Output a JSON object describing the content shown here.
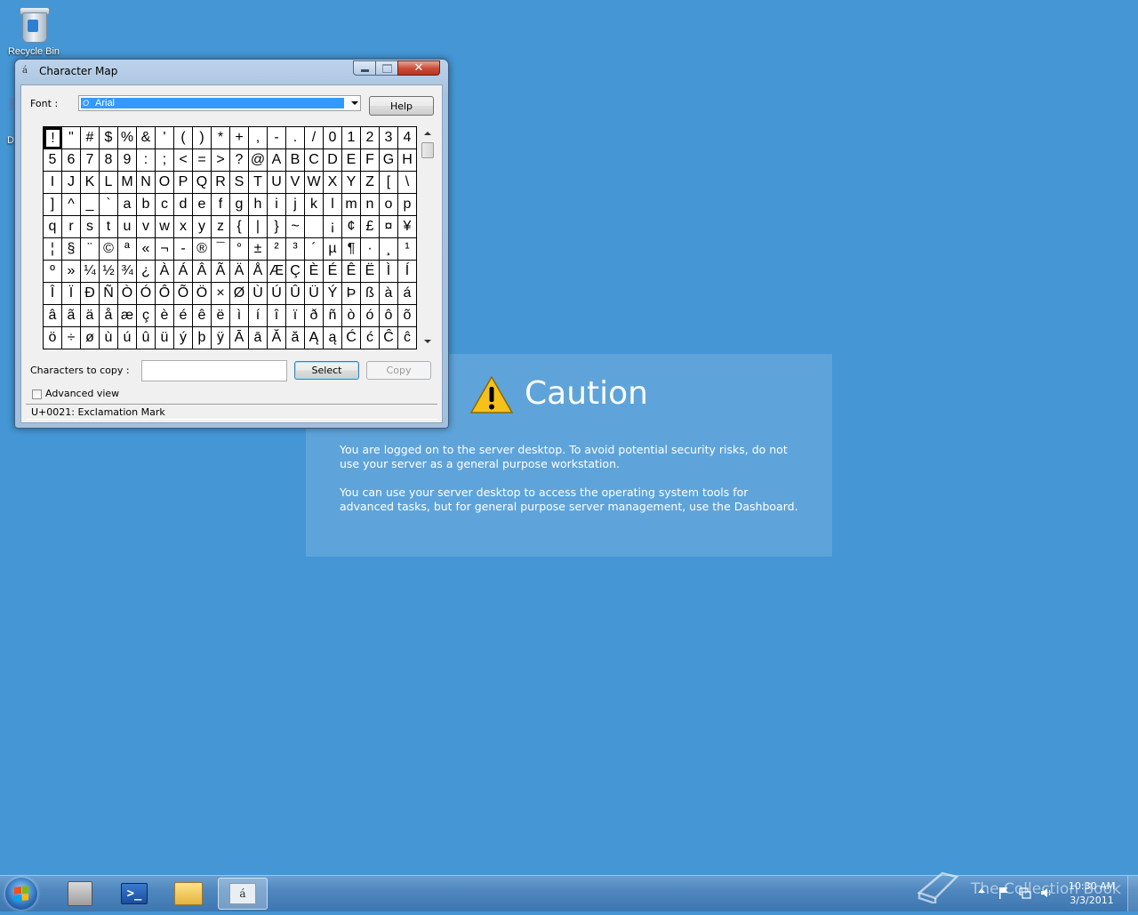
{
  "desktop": {
    "recycle_bin_label": "Recycle Bin",
    "second_icon_label": "D"
  },
  "caution": {
    "title": "Caution",
    "paragraph1": "You are logged on to the server desktop. To avoid potential security risks, do not use your server as a general purpose workstation.",
    "paragraph2": "You can use your server desktop to access the operating system tools for advanced tasks, but for general purpose server management, use the Dashboard."
  },
  "charmap": {
    "title": "Character Map",
    "font_label": "Font :",
    "font_value": "Arial",
    "help_label": "Help",
    "chars_to_copy_label": "Characters to copy :",
    "chars_to_copy_value": "",
    "select_label": "Select",
    "copy_label": "Copy",
    "advanced_view_label": "Advanced view",
    "advanced_view_checked": false,
    "status_text": "U+0021: Exclamation Mark",
    "selected_char": "!",
    "characters": [
      "!",
      "\"",
      "#",
      "$",
      "%",
      "&",
      "'",
      "(",
      ")",
      "*",
      "+",
      ",",
      "-",
      ".",
      "/",
      "0",
      "1",
      "2",
      "3",
      "4",
      "5",
      "6",
      "7",
      "8",
      "9",
      ":",
      ";",
      "<",
      "=",
      ">",
      "?",
      "@",
      "A",
      "B",
      "C",
      "D",
      "E",
      "F",
      "G",
      "H",
      "I",
      "J",
      "K",
      "L",
      "M",
      "N",
      "O",
      "P",
      "Q",
      "R",
      "S",
      "T",
      "U",
      "V",
      "W",
      "X",
      "Y",
      "Z",
      "[",
      "\\",
      "]",
      "^",
      "_",
      "`",
      "a",
      "b",
      "c",
      "d",
      "e",
      "f",
      "g",
      "h",
      "i",
      "j",
      "k",
      "l",
      "m",
      "n",
      "o",
      "p",
      "q",
      "r",
      "s",
      "t",
      "u",
      "v",
      "w",
      "x",
      "y",
      "z",
      "{",
      "|",
      "}",
      "~",
      " ",
      "¡",
      "¢",
      "£",
      "¤",
      "¥",
      "¦",
      "§",
      "¨",
      "©",
      "ª",
      "«",
      "¬",
      "-",
      "®",
      "¯",
      "°",
      "±",
      "²",
      "³",
      "´",
      "µ",
      "¶",
      "·",
      "¸",
      "¹",
      "º",
      "»",
      "¼",
      "½",
      "¾",
      "¿",
      "À",
      "Á",
      "Â",
      "Ã",
      "Ä",
      "Å",
      "Æ",
      "Ç",
      "È",
      "É",
      "Ê",
      "Ë",
      "Ì",
      "Í",
      "Î",
      "Ï",
      "Ð",
      "Ñ",
      "Ò",
      "Ó",
      "Ô",
      "Õ",
      "Ö",
      "×",
      "Ø",
      "Ù",
      "Ú",
      "Û",
      "Ü",
      "Ý",
      "Þ",
      "ß",
      "à",
      "á",
      "â",
      "ã",
      "ä",
      "å",
      "æ",
      "ç",
      "è",
      "é",
      "ê",
      "ë",
      "ì",
      "í",
      "î",
      "ï",
      "ð",
      "ñ",
      "ò",
      "ó",
      "ô",
      "õ",
      "ö",
      "÷",
      "ø",
      "ù",
      "ú",
      "û",
      "ü",
      "ý",
      "þ",
      "ÿ",
      "Ā",
      "ā",
      "Ă",
      "ă",
      "Ą",
      "ą",
      "Ć",
      "ć",
      "Ĉ",
      "ĉ"
    ]
  },
  "taskbar": {
    "items": [
      {
        "name": "server-manager-icon"
      },
      {
        "name": "powershell-icon"
      },
      {
        "name": "file-explorer-icon"
      },
      {
        "name": "character-map-icon",
        "active": true
      }
    ],
    "clock_time": "10:30 AM",
    "clock_date": "3/3/2011"
  },
  "watermark": "The Collection Book",
  "colors": {
    "desktop_bg": "#4496d4",
    "selection_blue": "#3399ff",
    "close_red": "#c94a36"
  }
}
